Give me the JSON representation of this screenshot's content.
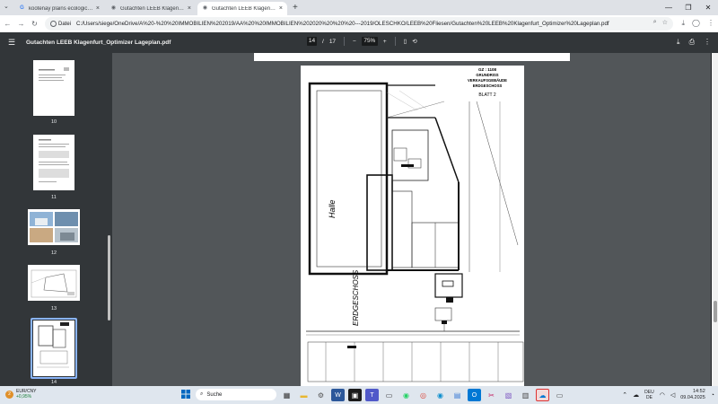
{
  "browser": {
    "tabs": [
      {
        "title": "kootenay plains ecological rese",
        "icon": "google-icon"
      },
      {
        "title": "Gutachten LEEB Klagenfurt_Opt",
        "icon": "pdf-icon"
      },
      {
        "title": "Gutachten LEEB Klagenfurt_Opt",
        "icon": "pdf-icon",
        "active": true
      }
    ],
    "new_tab": "+",
    "chip_label": "Datei",
    "url": "C:/Users/siege/OneDrive/A%20-%20%20IMMOBILIEN%202019/AA%20%20IMMOBILIEN%202020%20%20%20---2019/OLESCHKO/LEEB%20Fliesen/Gutachten%20LEEB%20Klagenfurt_Optimizer%20Lageplan.pdf"
  },
  "pdf": {
    "title": "Gutachten LEEB Klagenfurt_Optimizer Lageplan.pdf",
    "current_page": "14",
    "page_sep": "/",
    "total_pages": "17",
    "zoom": "75%"
  },
  "thumbnails": [
    {
      "label": "10"
    },
    {
      "label": "11"
    },
    {
      "label": "12"
    },
    {
      "label": "13"
    },
    {
      "label": "14"
    }
  ],
  "plan": {
    "header_line1": "GZ : 1108",
    "header_line2": "GRUNDRISS",
    "header_line3": "VERKAUFSGEBÄUDE",
    "header_line4": "ERDGESCHOSS",
    "header_line5": "BLATT 2",
    "halle": "Halle",
    "erdgeschoss": "ERDGESCHOSS"
  },
  "taskbar": {
    "ticker": "EUR/CNY",
    "ticker_change": "+0,95%",
    "badge": "2",
    "search": "Suche",
    "lang1": "DEU",
    "lang2": "DE",
    "time": "14:52",
    "date": "09.04.2025"
  },
  "colors": {
    "pdf_toolbar": "#323639",
    "viewer_bg": "#525659",
    "taskbar": "#dfe6ee",
    "accent": "#0067c0"
  }
}
